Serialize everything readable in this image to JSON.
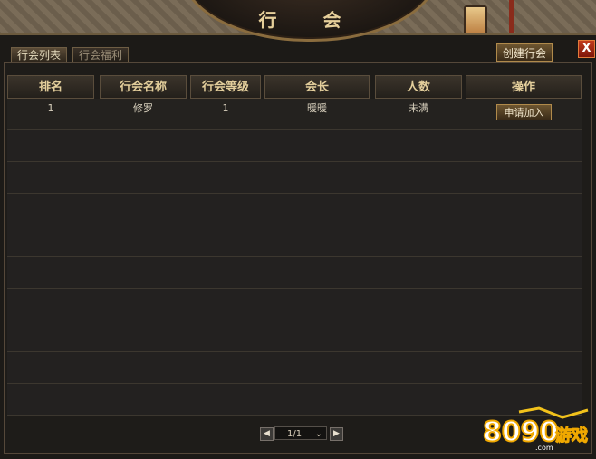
{
  "window": {
    "title": "行 会",
    "close_label": "X"
  },
  "tabs": [
    {
      "label": "行会列表",
      "active": true
    },
    {
      "label": "行会福利",
      "active": false
    }
  ],
  "create_button": "创建行会",
  "table": {
    "headers": [
      "排名",
      "行会名称",
      "行会等级",
      "会长",
      "人数",
      "操作"
    ],
    "rows": [
      {
        "rank": "1",
        "name": "修罗",
        "level": "1",
        "leader": "暖暖",
        "members": "未满",
        "action": "申请加入"
      }
    ],
    "empty_rows": 9
  },
  "pager": {
    "prev_icon": "chevron-left-icon",
    "next_icon": "chevron-right-icon",
    "page": "1/1"
  },
  "watermark": {
    "text": "8090游戏",
    "domain": ".com"
  },
  "colors": {
    "header_text": "#e4cf9c",
    "accent_gold": "#b08a4b",
    "close_red": "#c23b1d"
  }
}
